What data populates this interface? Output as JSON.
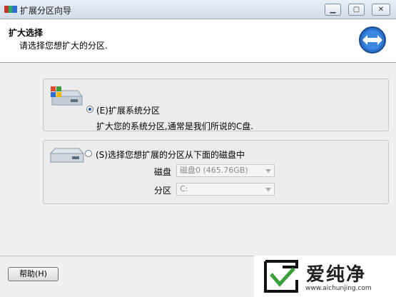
{
  "window": {
    "title": "扩展分区向导"
  },
  "header": {
    "title": "扩大选择",
    "subtitle": "请选择您想扩大的分区."
  },
  "option1": {
    "label": "(E)扩展系统分区",
    "description": "扩大您的系统分区,通常是我们所说的C盘."
  },
  "option2": {
    "label": "(S)选择您想扩展的分区从下面的磁盘中",
    "disk_label": "磁盘",
    "disk_value": "磁盘0 (465.76GB)",
    "partition_label": "分区",
    "partition_value": "C:"
  },
  "footer": {
    "help_label": "帮助(H)"
  },
  "watermark": {
    "brand": "爱纯净",
    "url": "www.aichunjing.com"
  }
}
